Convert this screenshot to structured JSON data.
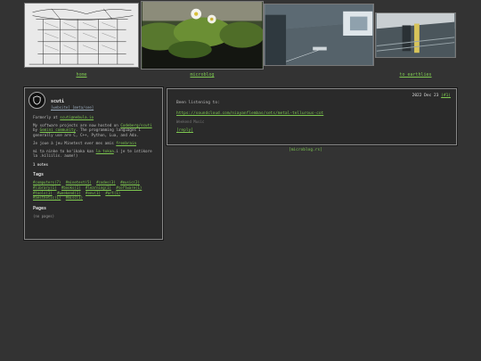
{
  "banner": {
    "items": [
      {
        "label": "home"
      },
      {
        "label": "microblog"
      },
      {
        "label": ""
      },
      {
        "label": "to earthlies"
      }
    ]
  },
  "profile": {
    "name": "scuti",
    "links": "[website] [meta/see]",
    "formerly": "Formerly at ",
    "formerly_link": "scuti@nebula.io",
    "software": "My software projects are now hosted on ",
    "software_link1": "Codeberg/scuti",
    "software_mid": " by ",
    "software_link2": "Gemini community",
    "software_end": ". The programming languages I generally use are C, C++, Python, Lua, and Ada.",
    "minetest_prefix": "Je joue à jeu Minetest ever mes amis ",
    "minetest_link": "frenbrain",
    "toki_prefix": "mi ta ninke to ke'ikaka kan ",
    "toki_link": "la tokaa",
    "toki_end": ".i je te intikore la .kiliilis. aume!)",
    "notes": "1 notes",
    "tags_heading": "Tags",
    "tags": [
      "#computers(7)",
      "#minetest(5)",
      "#codes(3)",
      "#music(2)",
      "#library(1)",
      "#books(1)",
      "#learning(1)",
      "#software(1)",
      "#tools(1)",
      "#weekend(1)",
      "#env(1)",
      "#art(1)",
      "#aesthetic(1)",
      "#misc(1)"
    ],
    "pages_heading": "Pages",
    "pages": "(no pages)"
  },
  "post": {
    "date": "2022 Dec 23 ",
    "date_link": "(#1)",
    "body": "Been listening to:",
    "url": "https://soundcloud.com/niayanflembas/sets/metal-tellurous-cot",
    "note": "Weekend Music",
    "reply": "[reply]"
  },
  "footer": {
    "link": "[microblog.rs]"
  }
}
